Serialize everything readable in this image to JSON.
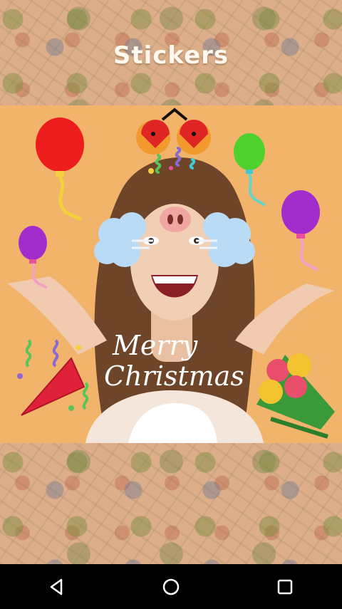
{
  "header": {
    "title": "Stickers"
  },
  "canvas": {
    "sticker_text_line1": "Merry",
    "sticker_text_line2": "Christmas"
  },
  "stickers": [
    "balloon-red",
    "balloon-green",
    "balloon-purple-left",
    "balloon-purple-right",
    "ladybug-headband",
    "pig-nose",
    "cloud-left",
    "cloud-right",
    "confetti",
    "party-popper",
    "flower-bouquet"
  ],
  "navbar": {
    "back": "back-icon",
    "home": "home-icon",
    "recents": "recents-icon"
  },
  "colors": {
    "photo_bg": "#f1b46a",
    "nav_bg": "#000000",
    "balloon_red": "#ee1d1d",
    "balloon_green": "#4fd12e",
    "balloon_purple": "#a32ccc"
  }
}
